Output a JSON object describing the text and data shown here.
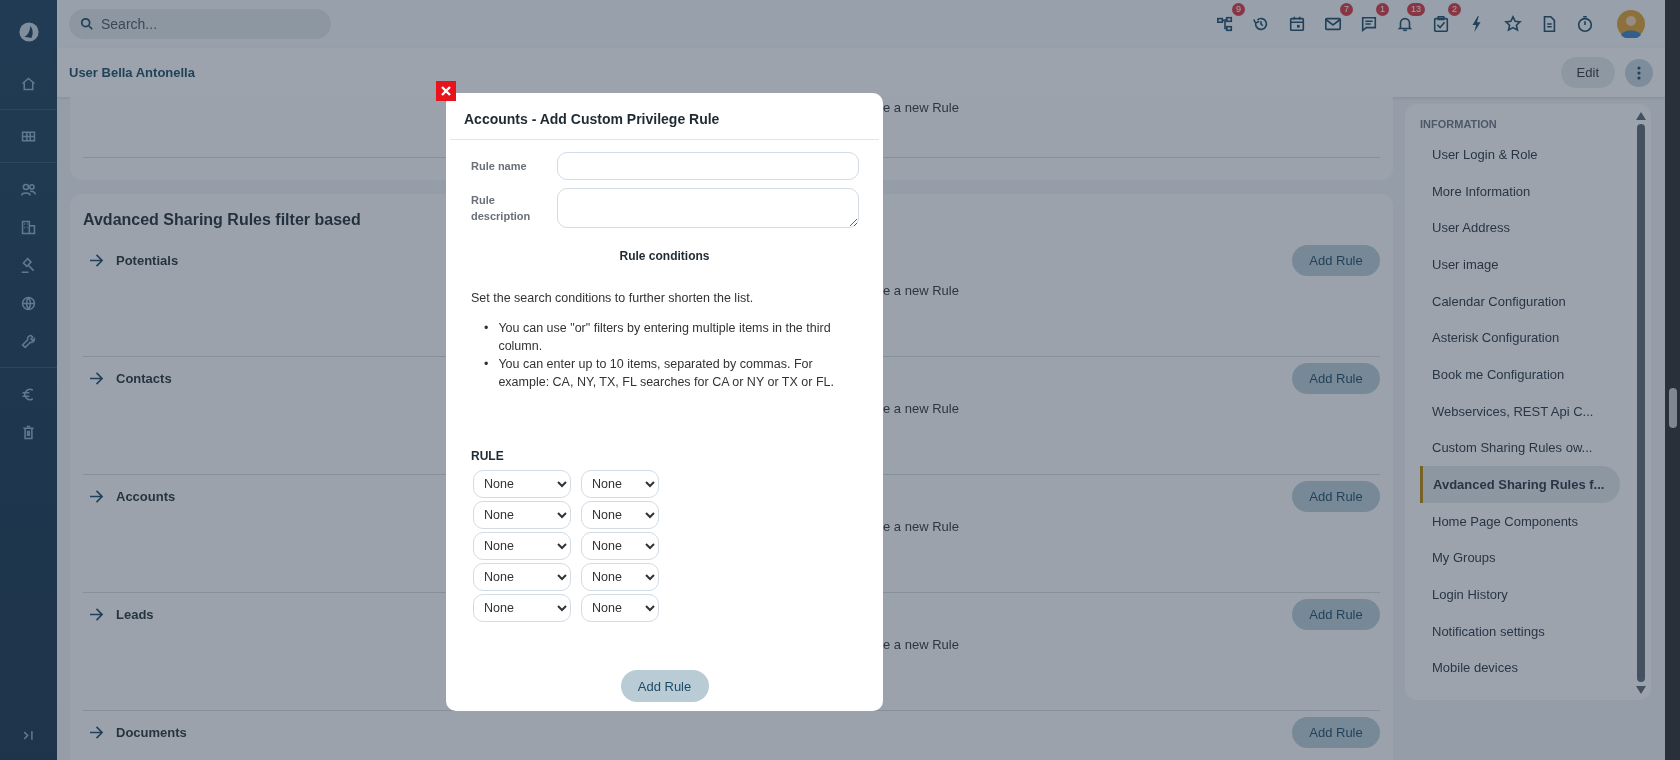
{
  "topbar": {
    "search": {
      "placeholder": "Search..."
    },
    "icons": [
      {
        "kind": "hierarchy",
        "badge": "9"
      },
      {
        "kind": "history"
      },
      {
        "kind": "calendar"
      },
      {
        "kind": "mail",
        "badge": "7"
      },
      {
        "kind": "chat",
        "badge": "1"
      },
      {
        "kind": "bell",
        "badge": "13"
      },
      {
        "kind": "tasks",
        "badge": "2"
      },
      {
        "kind": "bolt"
      },
      {
        "kind": "star"
      },
      {
        "kind": "document"
      },
      {
        "kind": "timer"
      }
    ]
  },
  "header": {
    "title": "User Bella Antonella",
    "edit_button": "Edit"
  },
  "content": {
    "top_card": {
      "hint": "e a new Rule"
    },
    "section_title": "Avdanced Sharing Rules filter based",
    "modules": [
      {
        "name": "Potentials",
        "button": "Add Rule",
        "hint": "e a new Rule"
      },
      {
        "name": "Contacts",
        "button": "Add Rule",
        "hint": "e a new Rule"
      },
      {
        "name": "Accounts",
        "button": "Add Rule",
        "hint": "e a new Rule"
      },
      {
        "name": "Leads",
        "button": "Add Rule",
        "hint": "e a new Rule"
      },
      {
        "name": "Documents",
        "button": "Add Rule"
      }
    ]
  },
  "sidebar": {
    "heading": "INFORMATION",
    "items": [
      {
        "label": "User Login & Role",
        "selected": false
      },
      {
        "label": "More Information",
        "selected": false
      },
      {
        "label": "User Address",
        "selected": false
      },
      {
        "label": "User image",
        "selected": false
      },
      {
        "label": "Calendar Configuration",
        "selected": false
      },
      {
        "label": "Asterisk Configuration",
        "selected": false
      },
      {
        "label": "Book me Configuration",
        "selected": false
      },
      {
        "label": "Webservices, REST Api C...",
        "selected": false
      },
      {
        "label": "Custom Sharing Rules ow...",
        "selected": false
      },
      {
        "label": "Avdanced Sharing Rules f...",
        "selected": true
      },
      {
        "label": "Home Page Components",
        "selected": false
      },
      {
        "label": "My Groups",
        "selected": false
      },
      {
        "label": "Login History",
        "selected": false
      },
      {
        "label": "Notification settings",
        "selected": false
      },
      {
        "label": "Mobile devices",
        "selected": false
      }
    ]
  },
  "modal": {
    "title": "Accounts - Add Custom Privilege Rule",
    "fields": [
      {
        "label": "Rule name",
        "kind": "input"
      },
      {
        "label": "Rule description",
        "kind": "textarea"
      }
    ],
    "conditions_title": "Rule conditions",
    "intro": "Set the search conditions to further shorten the list.",
    "bullets": [
      {
        "marker": "•",
        "text": "You can use \"or\" filters by entering multiple items in the third column."
      },
      {
        "marker": "•",
        "text": "You can enter up to 10 items, separated by commas. For example: CA, NY, TX, FL searches for CA or NY or TX or FL."
      }
    ],
    "rule_label": "RULE",
    "rule_rows": [
      [
        "None",
        "None"
      ],
      [
        "None",
        "None"
      ],
      [
        "None",
        "None"
      ],
      [
        "None",
        "None"
      ],
      [
        "None",
        "None"
      ]
    ],
    "submit_button": "Add Rule"
  }
}
